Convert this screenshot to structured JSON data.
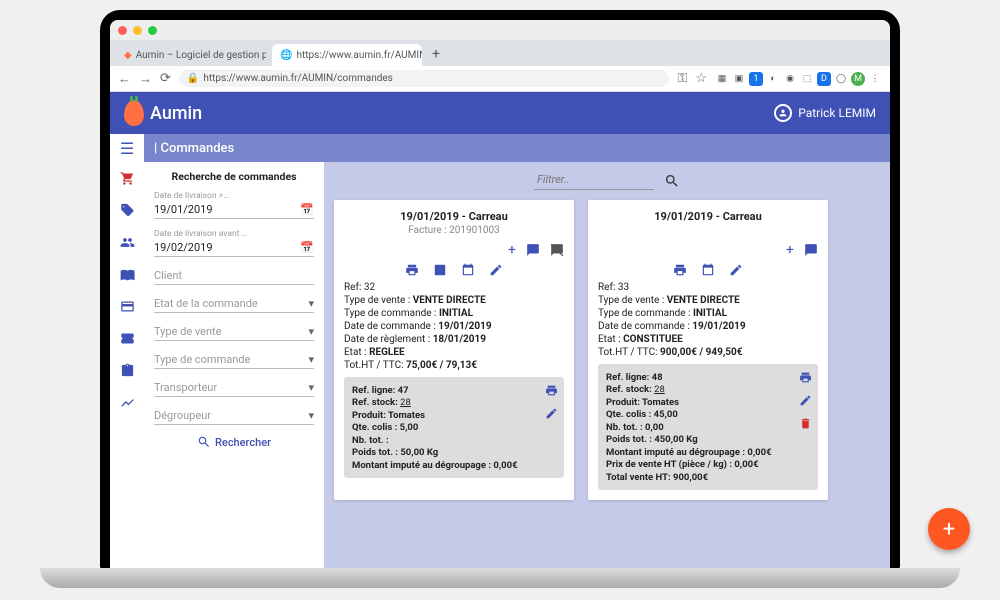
{
  "browser": {
    "tab1": "Aumin – Logiciel de gestion pou…",
    "tab2": "https://www.aumin.fr/AUMIN/c…",
    "url": "https://www.aumin.fr/AUMIN/commandes"
  },
  "header": {
    "brand": "Aumin",
    "user": "Patrick LEMIM"
  },
  "subheader": {
    "title": "| Commandes"
  },
  "search": {
    "title": "Recherche de commandes",
    "date_after_lbl": "Date de livraison >…",
    "date_after_val": "19/01/2019",
    "date_before_lbl": "Date de livraison avant …",
    "date_before_val": "19/02/2019",
    "client_lbl": "Client",
    "etat_lbl": "Etat de la commande",
    "type_vente_lbl": "Type de vente",
    "type_cmd_lbl": "Type de commande",
    "transporteur_lbl": "Transporteur",
    "degroupeur_lbl": "Dégroupeur",
    "button": "Rechercher"
  },
  "filter": {
    "placeholder": "Filtrer.."
  },
  "card1": {
    "header": "19/01/2019 - Carreau",
    "sub": "Facture : 201901003",
    "ref": "Ref: 32",
    "type_vente": "Type de vente : ",
    "type_vente_v": "VENTE DIRECTE",
    "type_cmd": "Type de commande : ",
    "type_cmd_v": "INITIAL",
    "date_cmd": "Date de commande : ",
    "date_cmd_v": "19/01/2019",
    "date_reg": "Date de règlement : ",
    "date_reg_v": "18/01/2019",
    "etat": "Etat : ",
    "etat_v": "REGLEE",
    "tot": "Tot.HT / TTC: ",
    "tot_v": "75,00€ / 79,13€",
    "line": {
      "ref_ligne": "Ref. ligne: 47",
      "ref_stock_l": "Ref. stock: ",
      "ref_stock_v": "28",
      "produit": "Produit: Tomates",
      "qte": "Qte. colis : 5,00",
      "nb": "Nb. tot. : ",
      "poids": "Poids tot. : 50,00 Kg",
      "montant": "Montant imputé au dégroupage : 0,00€"
    }
  },
  "card2": {
    "header": "19/01/2019 - Carreau",
    "ref": "Ref: 33",
    "type_vente": "Type de vente : ",
    "type_vente_v": "VENTE DIRECTE",
    "type_cmd": "Type de commande : ",
    "type_cmd_v": "INITIAL",
    "date_cmd": "Date de commande : ",
    "date_cmd_v": "19/01/2019",
    "etat": "Etat : ",
    "etat_v": "CONSTITUEE",
    "tot": "Tot.HT / TTC: ",
    "tot_v": "900,00€ / 949,50€",
    "line": {
      "ref_ligne": "Ref. ligne: 48",
      "ref_stock_l": "Ref. stock: ",
      "ref_stock_v": "28",
      "produit": "Produit: Tomates",
      "qte": "Qte. colis : 45,00",
      "nb": "Nb. tot. : 0,00",
      "poids": "Poids tot. : 450,00 Kg",
      "montant": "Montant imputé au dégroupage : 0,00€",
      "prix": "Prix de vente HT (pièce / kg) : 0,00€",
      "total": "Total vente HT: 900,00€"
    }
  }
}
